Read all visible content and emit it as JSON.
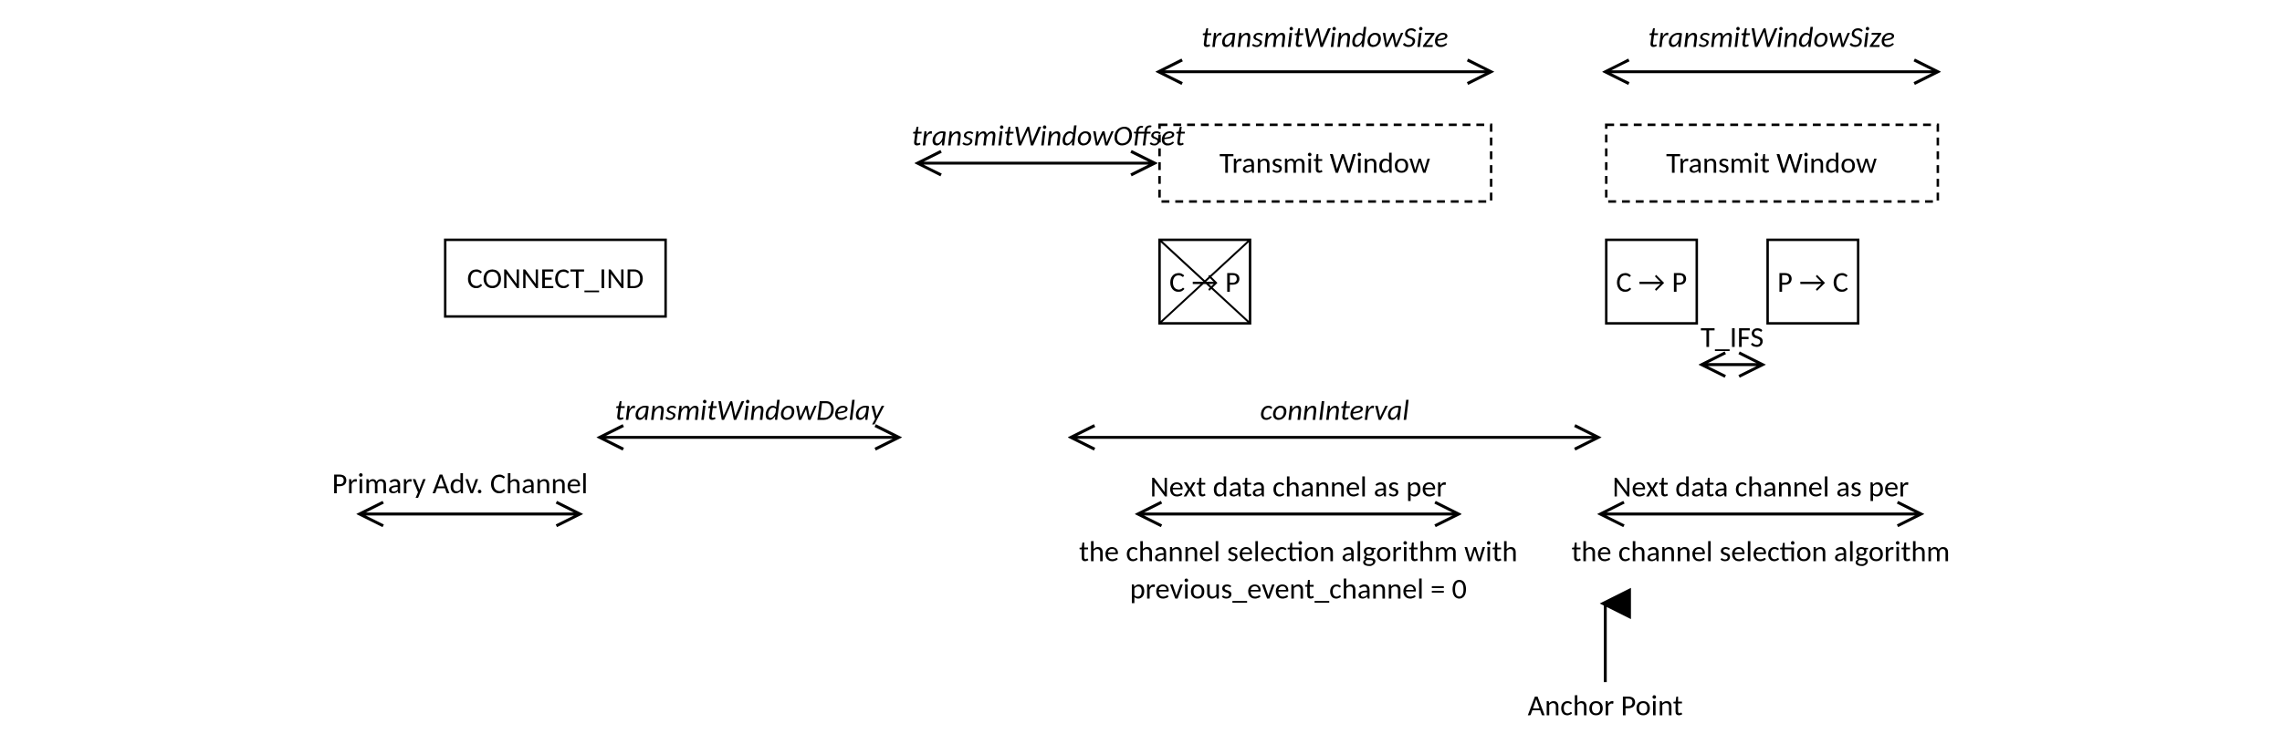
{
  "labels": {
    "tws_top_1": "transmitWindowSize",
    "tws_top_2": "transmitWindowSize",
    "tw_box_1": "Transmit Window",
    "tw_box_2": "Transmit Window",
    "two": "transmitWindowOffset",
    "connect_ind": "CONNECT_IND",
    "cp1": "C → P",
    "cp2": "C → P",
    "pc": "P → C",
    "tifs": "T_IFS",
    "twd": "transmitWindowDelay",
    "conn_interval": "connInterval",
    "primary": "Primary Adv. Channel",
    "next1a": "Next data channel as per",
    "next1b": "the channel selection algorithm with",
    "next1c": "previous_event_channel = 0",
    "next2a": "Next data channel as per",
    "next2b": "the channel selection algorithm",
    "anchor": "Anchor Point"
  }
}
